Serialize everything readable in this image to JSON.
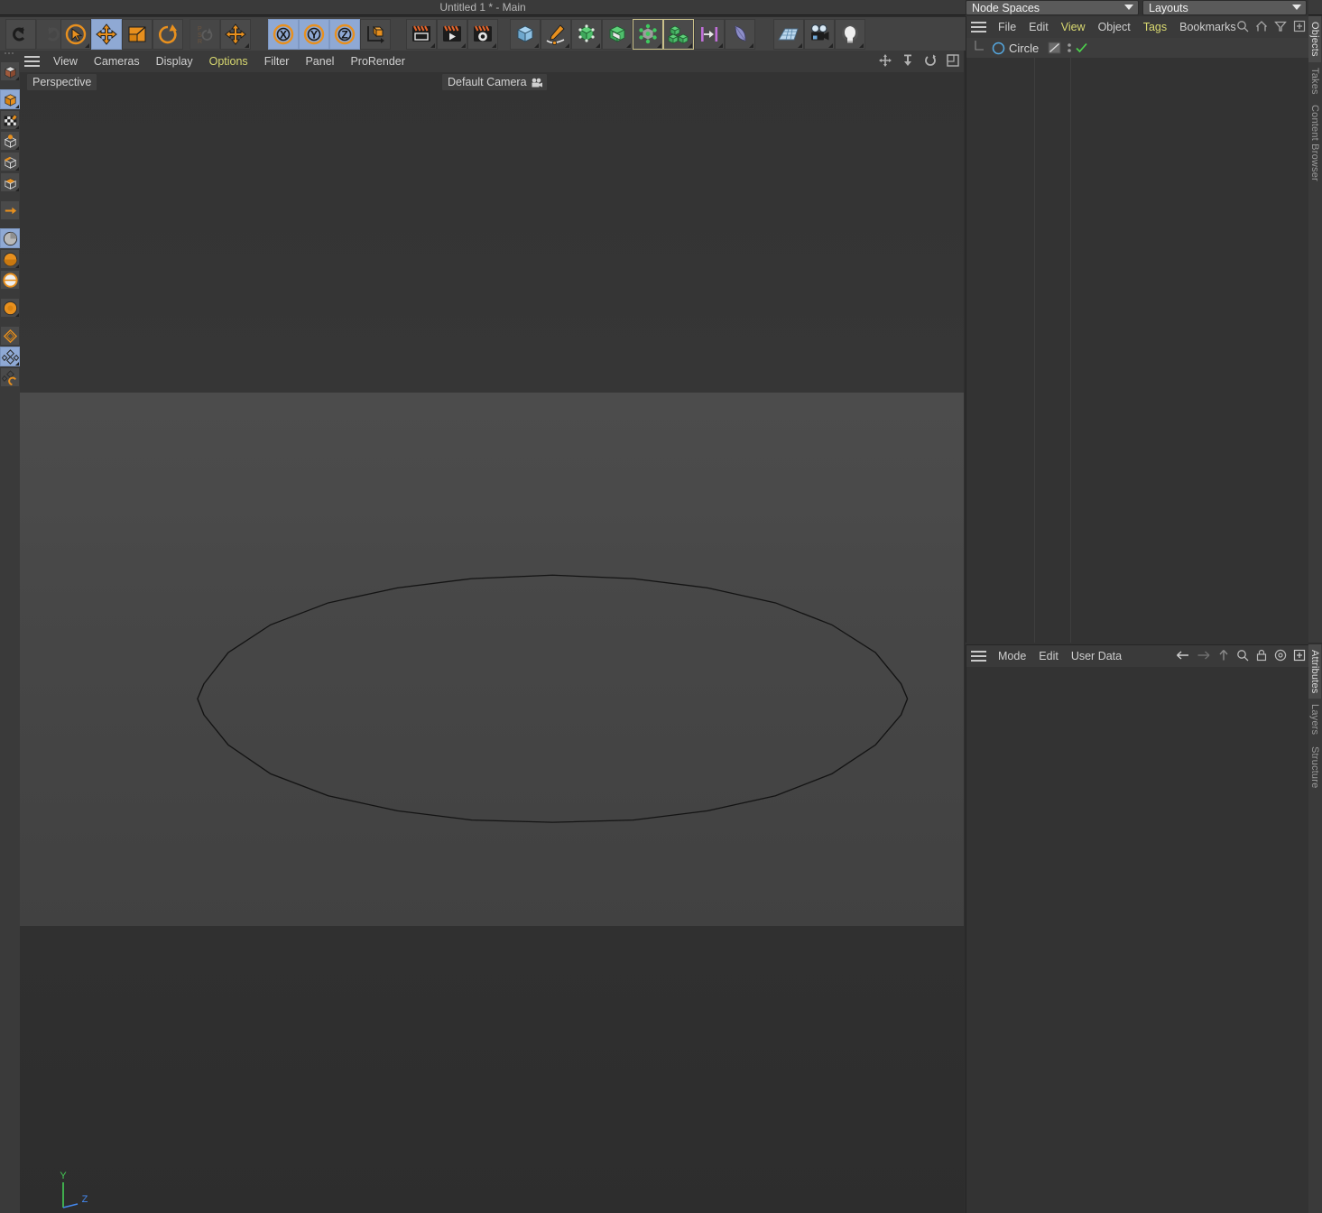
{
  "window": {
    "title": "Untitled 1 * - Main"
  },
  "top_toolbar": {
    "groups": [
      {
        "name": "history",
        "buttons": [
          {
            "id": "undo",
            "icon": "undo-icon",
            "state": "normal"
          },
          {
            "id": "redo",
            "icon": "redo-icon",
            "state": "disabled"
          }
        ]
      },
      {
        "name": "tools",
        "buttons": [
          {
            "id": "live-selection",
            "icon": "selection-cursor-icon",
            "state": "normal"
          },
          {
            "id": "move",
            "icon": "move-arrows-icon",
            "state": "active"
          },
          {
            "id": "scale",
            "icon": "scale-icon",
            "state": "normal"
          },
          {
            "id": "rotate",
            "icon": "rotate-icon",
            "state": "normal"
          }
        ]
      },
      {
        "name": "psr",
        "buttons": [
          {
            "id": "psr-reset",
            "icon": "psr-reset-icon",
            "state": "disabled"
          },
          {
            "id": "world-object-axis",
            "icon": "move-axis-icon",
            "state": "normal"
          }
        ]
      },
      {
        "name": "axis-locks",
        "buttons": [
          {
            "id": "lock-x",
            "icon": "x-axis-icon",
            "label": "X",
            "state": "active"
          },
          {
            "id": "lock-y",
            "icon": "y-axis-icon",
            "label": "Y",
            "state": "active"
          },
          {
            "id": "lock-z",
            "icon": "z-axis-icon",
            "label": "Z",
            "state": "active"
          },
          {
            "id": "world-coordinates",
            "icon": "world-axis-cube-icon",
            "state": "normal"
          }
        ]
      },
      {
        "name": "render",
        "buttons": [
          {
            "id": "render-view",
            "icon": "render-view-icon",
            "state": "normal"
          },
          {
            "id": "render-to-picture-viewer",
            "icon": "render-picture-viewer-icon",
            "state": "normal"
          },
          {
            "id": "render-settings",
            "icon": "render-settings-icon",
            "state": "normal"
          }
        ]
      },
      {
        "name": "create",
        "buttons": [
          {
            "id": "add-cube",
            "icon": "cube-primitive-icon",
            "state": "normal"
          },
          {
            "id": "add-spline",
            "icon": "pen-spline-icon",
            "state": "normal"
          },
          {
            "id": "nurbs",
            "icon": "green-nurbs-icon",
            "state": "normal"
          },
          {
            "id": "array-generator",
            "icon": "green-box-generator-icon",
            "state": "normal"
          },
          {
            "id": "deformer",
            "icon": "deformer-icon",
            "state": "highlight"
          },
          {
            "id": "mograph",
            "icon": "mograph-cloner-icon",
            "state": "highlight"
          },
          {
            "id": "scene-constraint",
            "icon": "scene-axis-icon",
            "state": "normal"
          },
          {
            "id": "field",
            "icon": "field-icon",
            "state": "normal"
          }
        ]
      },
      {
        "name": "environment",
        "buttons": [
          {
            "id": "add-floor",
            "icon": "floor-grid-icon",
            "state": "normal"
          },
          {
            "id": "add-camera",
            "icon": "camera-icon",
            "state": "normal"
          },
          {
            "id": "add-light",
            "icon": "light-bulb-icon",
            "state": "normal"
          }
        ]
      }
    ]
  },
  "left_toolbar": {
    "buttons": [
      {
        "id": "model-mode",
        "icon": "model-mode-icon",
        "state": "normal"
      },
      {
        "id": "object-mode",
        "icon": "object-mode-icon",
        "state": "active"
      },
      {
        "id": "texture-mode",
        "icon": "texture-mode-icon",
        "state": "normal"
      },
      {
        "id": "point-mode",
        "icon": "point-mode-icon",
        "state": "normal"
      },
      {
        "id": "edge-mode",
        "icon": "edge-mode-icon",
        "state": "normal"
      },
      {
        "id": "polygon-mode",
        "icon": "polygon-mode-icon",
        "state": "normal"
      },
      {
        "id": "axis-mode",
        "icon": "axis-mode-icon",
        "state": "normal"
      },
      {
        "id": "enable-axis",
        "icon": "enable-axis-icon",
        "state": "active"
      },
      {
        "id": "viewport-solo-off",
        "icon": "solo-off-icon",
        "state": "normal"
      },
      {
        "id": "viewport-solo-single",
        "icon": "solo-single-icon",
        "state": "normal"
      },
      {
        "id": "enable-snap",
        "icon": "snap-icon",
        "state": "normal"
      },
      {
        "id": "workplane",
        "icon": "workplane-icon",
        "state": "normal"
      },
      {
        "id": "quantize",
        "icon": "quantize-icon",
        "state": "active"
      },
      {
        "id": "lock-workplane",
        "icon": "lock-workplane-icon",
        "state": "normal"
      }
    ]
  },
  "viewport": {
    "menu": [
      {
        "id": "view",
        "label": "View",
        "highlight": false
      },
      {
        "id": "cameras",
        "label": "Cameras",
        "highlight": false
      },
      {
        "id": "display",
        "label": "Display",
        "highlight": false
      },
      {
        "id": "options",
        "label": "Options",
        "highlight": true
      },
      {
        "id": "filter",
        "label": "Filter",
        "highlight": false
      },
      {
        "id": "panel",
        "label": "Panel",
        "highlight": false
      },
      {
        "id": "prorender",
        "label": "ProRender",
        "highlight": false
      }
    ],
    "corner_icons": [
      "move-view-icon",
      "scale-view-icon",
      "rotate-view-icon",
      "maximize-view-icon"
    ],
    "projection_label": "Perspective",
    "camera_label": "Default Camera",
    "camera_icon": "camera-small-icon",
    "axis_gizmo": {
      "y_label": "Y",
      "z_label": "Z",
      "y_color": "#44cc55",
      "z_color": "#4488ee"
    },
    "object_outline_color": "#141414"
  },
  "node_spaces": {
    "label": "Node Spaces",
    "icon": "chevron-down-icon"
  },
  "layouts": {
    "label": "Layouts",
    "icon": "chevron-down-icon"
  },
  "object_manager": {
    "menu": [
      {
        "id": "file",
        "label": "File",
        "highlight": false
      },
      {
        "id": "edit",
        "label": "Edit",
        "highlight": false
      },
      {
        "id": "view",
        "label": "View",
        "highlight": true
      },
      {
        "id": "object",
        "label": "Object",
        "highlight": false
      },
      {
        "id": "tags",
        "label": "Tags",
        "highlight": true
      },
      {
        "id": "bookmarks",
        "label": "Bookmarks",
        "highlight": false
      }
    ],
    "icons": [
      "search-icon",
      "home-icon",
      "filter-icon",
      "plus-box-icon"
    ],
    "objects": [
      {
        "name": "Circle",
        "type_icon": "spline-circle-icon",
        "visible_editor": "default",
        "visible_render": "default",
        "tag_icon": "checkmark-icon",
        "selected": true
      }
    ]
  },
  "attributes": {
    "menu": [
      {
        "id": "mode",
        "label": "Mode"
      },
      {
        "id": "edit",
        "label": "Edit"
      },
      {
        "id": "user-data",
        "label": "User Data"
      }
    ],
    "icons": [
      "back-arrow-icon",
      "forward-arrow-icon",
      "up-arrow-icon",
      "search-icon",
      "lock-icon",
      "target-icon",
      "plus-box-icon"
    ],
    "content": ""
  },
  "right_tabs_top": [
    {
      "id": "objects",
      "label": "Objects",
      "active": true
    },
    {
      "id": "takes",
      "label": "Takes",
      "active": false
    },
    {
      "id": "content-browser",
      "label": "Content Browser",
      "active": false
    }
  ],
  "right_tabs_bottom": [
    {
      "id": "attributes",
      "label": "Attributes",
      "active": true
    },
    {
      "id": "layers",
      "label": "Layers",
      "active": false
    },
    {
      "id": "structure",
      "label": "Structure",
      "active": false
    }
  ],
  "colors": {
    "accent_orange": "#e8901e",
    "active_blue": "#8fa9d4",
    "menu_yellow": "#d8d870",
    "panel_bg": "#333333",
    "toolbar_bg": "#434343"
  }
}
